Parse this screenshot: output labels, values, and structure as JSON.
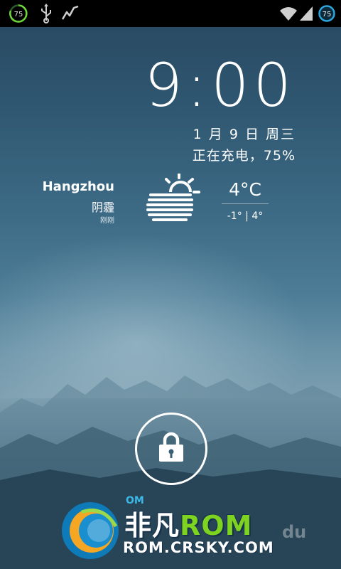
{
  "status_bar": {
    "left_badge": "75",
    "right_badge": "75"
  },
  "lockscreen": {
    "time": "9:00",
    "date": "1 月 9 日 周三",
    "charging": "正在充电，75%"
  },
  "weather": {
    "city": "Hangzhou",
    "condition": "阴霾",
    "updated": "刚刚",
    "temp": "4°C",
    "range": "-1° | 4°",
    "icon": "partly-cloudy-icon"
  },
  "unlock": {
    "icon": "lock-icon"
  },
  "watermark": {
    "title_prefix": "非凡",
    "title_rom": "ROM",
    "url": "ROM.CRSKY.COM",
    "small": "OM",
    "du": "du"
  }
}
